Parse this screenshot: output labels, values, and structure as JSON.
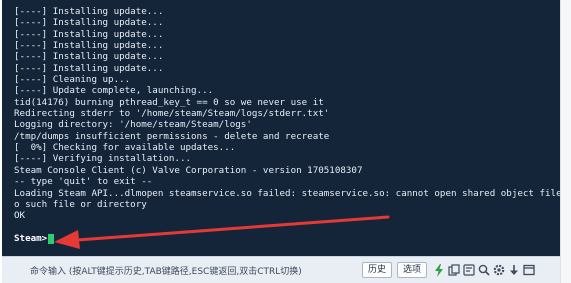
{
  "terminal": {
    "lines": [
      "[----] Installing update...",
      "[----] Installing update...",
      "[----] Installing update...",
      "[----] Installing update...",
      "[----] Installing update...",
      "[----] Installing update...",
      "[----] Cleaning up...",
      "[----] Update complete, launching...",
      "tid(14176) burning pthread_key_t == 0 so we never use it",
      "Redirecting stderr to '/home/steam/Steam/logs/stderr.txt'",
      "Logging directory: '/home/steam/Steam/logs'",
      "/tmp/dumps insufficient permissions - delete and recreate",
      "[  0%] Checking for available updates...",
      "[----] Verifying installation...",
      "Steam Console Client (c) Valve Corporation - version 1705108307",
      "-- type 'quit' to exit --",
      "Loading Steam API...dlmopen steamservice.so failed: steamservice.so: cannot open shared object file: N",
      "o such file or directory",
      "OK"
    ],
    "prompt": "Steam>",
    "text_color": "#e6edf5",
    "background": "#14253a",
    "cursor_color": "#2ecc71",
    "annotation_arrow_color": "#e53935"
  },
  "command_bar": {
    "input_placeholder": "命令输入 (按ALT键提示历史,TAB键路径,ESC键返回,双击CTRL切换)",
    "history_button": "历史",
    "options_button": "选项",
    "icons": [
      "lightning-icon",
      "copy-icon",
      "settings-icon",
      "search-icon",
      "gear-icon",
      "arrow-down-icon",
      "window-icon"
    ]
  }
}
